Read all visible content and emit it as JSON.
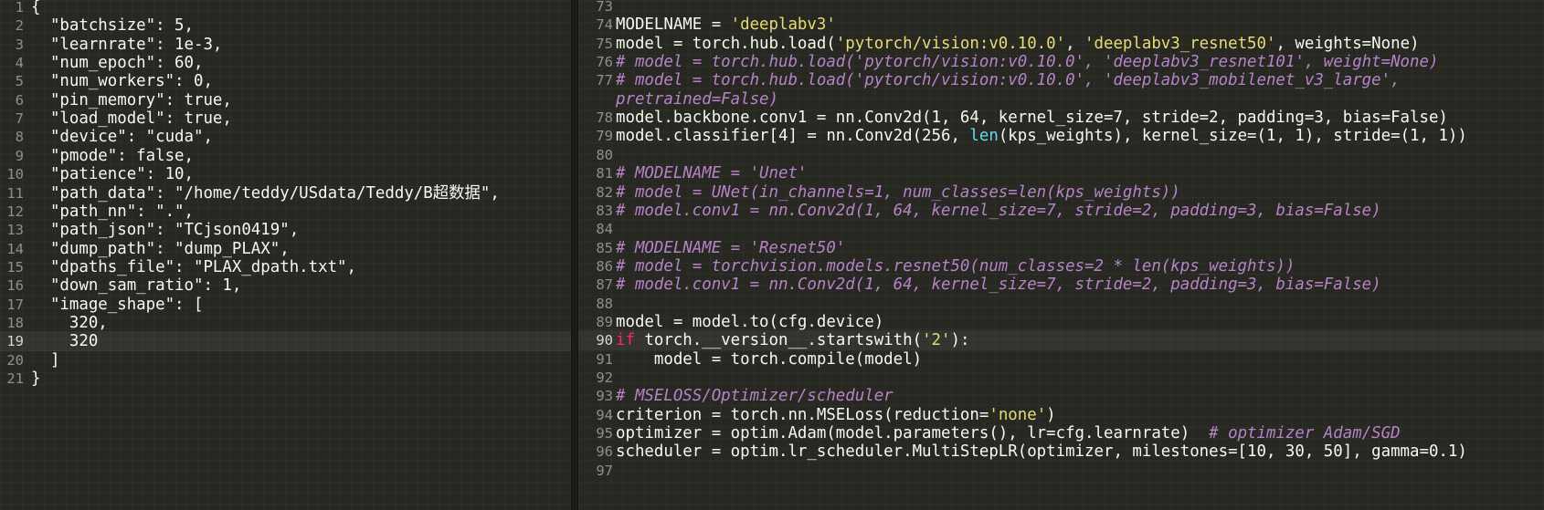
{
  "left_editor": {
    "lines": [
      {
        "n": "1",
        "tokens": [
          {
            "t": "{",
            "c": "plain"
          }
        ]
      },
      {
        "n": "2",
        "tokens": [
          {
            "t": "  \"batchsize\": 5,",
            "c": "plain"
          }
        ]
      },
      {
        "n": "3",
        "tokens": [
          {
            "t": "  \"learnrate\": 1e-3,",
            "c": "plain"
          }
        ]
      },
      {
        "n": "4",
        "tokens": [
          {
            "t": "  \"num_epoch\": 60,",
            "c": "plain"
          }
        ]
      },
      {
        "n": "5",
        "tokens": [
          {
            "t": "  \"num_workers\": 0,",
            "c": "plain"
          }
        ]
      },
      {
        "n": "6",
        "tokens": [
          {
            "t": "  \"pin_memory\": true,",
            "c": "plain"
          }
        ]
      },
      {
        "n": "7",
        "tokens": [
          {
            "t": "  \"load_model\": true,",
            "c": "plain"
          }
        ]
      },
      {
        "n": "8",
        "tokens": [
          {
            "t": "  \"device\": \"cuda\",",
            "c": "plain"
          }
        ]
      },
      {
        "n": "9",
        "tokens": [
          {
            "t": "  \"pmode\": false,",
            "c": "plain"
          }
        ]
      },
      {
        "n": "10",
        "tokens": [
          {
            "t": "  \"patience\": 10,",
            "c": "plain"
          }
        ]
      },
      {
        "n": "11",
        "tokens": [
          {
            "t": "  \"path_data\": \"/home/teddy/USdata/Teddy/B超数据\",",
            "c": "plain"
          }
        ]
      },
      {
        "n": "12",
        "tokens": [
          {
            "t": "  \"path_nn\": \".\",",
            "c": "plain"
          }
        ]
      },
      {
        "n": "13",
        "tokens": [
          {
            "t": "  \"path_json\": \"TCjson0419\",",
            "c": "plain"
          }
        ]
      },
      {
        "n": "14",
        "tokens": [
          {
            "t": "  \"dump_path\": \"dump_PLAX\",",
            "c": "plain"
          }
        ]
      },
      {
        "n": "15",
        "tokens": [
          {
            "t": "  \"dpaths_file\": \"PLAX_dpath.txt\",",
            "c": "plain"
          }
        ]
      },
      {
        "n": "16",
        "tokens": [
          {
            "t": "  \"down_sam_ratio\": 1,",
            "c": "plain"
          }
        ]
      },
      {
        "n": "17",
        "tokens": [
          {
            "t": "  \"image_shape\": [",
            "c": "plain"
          }
        ]
      },
      {
        "n": "18",
        "tokens": [
          {
            "t": "    320,",
            "c": "plain"
          }
        ]
      },
      {
        "n": "19",
        "tokens": [
          {
            "t": "    320",
            "c": "plain"
          }
        ]
      },
      {
        "n": "20",
        "tokens": [
          {
            "t": "  ]",
            "c": "plain"
          }
        ]
      },
      {
        "n": "21",
        "tokens": [
          {
            "t": "}",
            "c": "plain"
          }
        ]
      }
    ]
  },
  "right_editor": {
    "lines": [
      {
        "n": "73",
        "tokens": []
      },
      {
        "n": "74",
        "tokens": [
          {
            "t": "MODELNAME = ",
            "c": "plain"
          },
          {
            "t": "'deeplabv3'",
            "c": "str"
          }
        ]
      },
      {
        "n": "75",
        "tokens": [
          {
            "t": "model = torch.hub.load(",
            "c": "plain"
          },
          {
            "t": "'pytorch/vision:v0.10.0'",
            "c": "str"
          },
          {
            "t": ", ",
            "c": "plain"
          },
          {
            "t": "'deeplabv3_resnet50'",
            "c": "str"
          },
          {
            "t": ", weights=None)",
            "c": "plain"
          }
        ]
      },
      {
        "n": "76",
        "tokens": [
          {
            "t": "# model = torch.hub.load('pytorch/vision:v0.10.0', 'deeplabv3_resnet101', weight=None)",
            "c": "cmt"
          }
        ]
      },
      {
        "n": "77",
        "tokens": [
          {
            "t": "# model = torch.hub.load('pytorch/vision:v0.10.0', 'deeplabv3_mobilenet_v3_large',",
            "c": "cmt"
          }
        ]
      },
      {
        "n": "",
        "tokens": [
          {
            "t": "pretrained=False)",
            "c": "cmt"
          }
        ]
      },
      {
        "n": "78",
        "tokens": [
          {
            "t": "model.backbone.conv1 = nn.Conv2d(1, 64, kernel_size=7, stride=2, padding=3, bias=False)",
            "c": "plain"
          }
        ]
      },
      {
        "n": "79",
        "tokens": [
          {
            "t": "model.classifier[4] = nn.Conv2d(256, ",
            "c": "plain"
          },
          {
            "t": "len",
            "c": "bi"
          },
          {
            "t": "(kps_weights), kernel_size=(1, 1), stride=(1, 1))",
            "c": "plain"
          }
        ]
      },
      {
        "n": "80",
        "tokens": []
      },
      {
        "n": "81",
        "tokens": [
          {
            "t": "# MODELNAME = 'Unet'",
            "c": "cmt"
          }
        ]
      },
      {
        "n": "82",
        "tokens": [
          {
            "t": "# model = UNet(in_channels=1, num_classes=len(kps_weights))",
            "c": "cmt"
          }
        ]
      },
      {
        "n": "83",
        "tokens": [
          {
            "t": "# model.conv1 = nn.Conv2d(1, 64, kernel_size=7, stride=2, padding=3, bias=False)",
            "c": "cmt"
          }
        ]
      },
      {
        "n": "84",
        "tokens": []
      },
      {
        "n": "85",
        "tokens": [
          {
            "t": "# MODELNAME = 'Resnet50'",
            "c": "cmt"
          }
        ]
      },
      {
        "n": "86",
        "tokens": [
          {
            "t": "# model = torchvision.models.resnet50(num_classes=2 * len(kps_weights))",
            "c": "cmt"
          }
        ]
      },
      {
        "n": "87",
        "tokens": [
          {
            "t": "# model.conv1 = nn.Conv2d(1, 64, kernel_size=7, stride=2, padding=3, bias=False)",
            "c": "cmt"
          }
        ]
      },
      {
        "n": "88",
        "tokens": []
      },
      {
        "n": "89",
        "tokens": [
          {
            "t": "model = model.to(cfg.device)",
            "c": "plain"
          }
        ]
      },
      {
        "n": "90",
        "tokens": [
          {
            "t": "if",
            "c": "kw"
          },
          {
            "t": " torch.__version__.startswith(",
            "c": "plain"
          },
          {
            "t": "'2'",
            "c": "str"
          },
          {
            "t": "):",
            "c": "plain"
          }
        ]
      },
      {
        "n": "91",
        "tokens": [
          {
            "t": "    model = torch.compile(model)",
            "c": "plain"
          }
        ]
      },
      {
        "n": "92",
        "tokens": []
      },
      {
        "n": "93",
        "tokens": [
          {
            "t": "# MSELOSS/Optimizer/scheduler",
            "c": "cmt"
          }
        ]
      },
      {
        "n": "94",
        "tokens": [
          {
            "t": "criterion = torch.nn.MSELoss(reduction=",
            "c": "plain"
          },
          {
            "t": "'none'",
            "c": "str"
          },
          {
            "t": ")",
            "c": "plain"
          }
        ]
      },
      {
        "n": "95",
        "tokens": [
          {
            "t": "optimizer = optim.Adam(model.parameters(), lr=cfg.learnrate)  ",
            "c": "plain"
          },
          {
            "t": "# optimizer Adam/SGD",
            "c": "cmt"
          }
        ]
      },
      {
        "n": "96",
        "tokens": [
          {
            "t": "scheduler = optim.lr_scheduler.MultiStepLR(optimizer, milestones=[10, 30, 50], gamma=0.1)",
            "c": "plain"
          }
        ]
      },
      {
        "n": "97",
        "tokens": []
      }
    ]
  },
  "theme": {
    "background": "#272822",
    "text": "#f8f8f2",
    "string": "#e6db74",
    "comment": "#b783c8",
    "keyword": "#f92672",
    "builtin": "#66d9ef",
    "line_number": "#90908a"
  }
}
